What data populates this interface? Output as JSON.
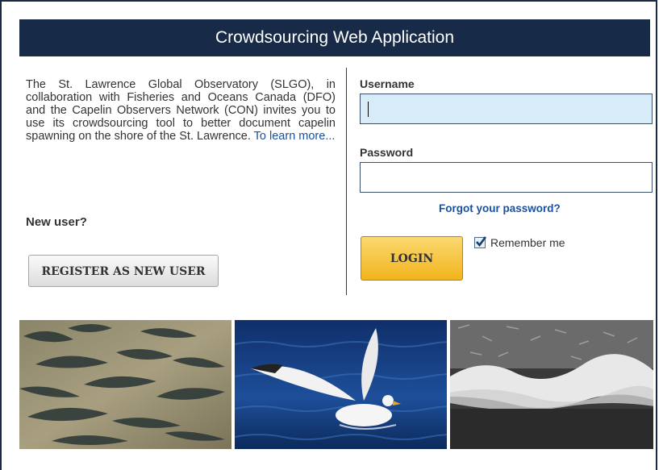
{
  "header": {
    "title": "Crowdsourcing Web Application"
  },
  "intro": {
    "text": "The St. Lawrence Global Observatory (SLGO), in collaboration with Fisheries and Oceans Canada (DFO) and the Capelin Observers Network (CON) invites you to use its crowdsourcing tool to better document capelin spawning on the shore of the St. Lawrence. ",
    "link_text": "To learn more..."
  },
  "new_user": {
    "heading": "New user?",
    "register_label": "REGISTER AS NEW USER"
  },
  "login": {
    "username_label": "Username",
    "username_value": "",
    "password_label": "Password",
    "password_value": "",
    "forgot_label": "Forgot your password?",
    "login_label": "LOGIN",
    "remember_label": "Remember me",
    "remember_checked": true
  },
  "photos": [
    {
      "name": "capelin-fish-photo"
    },
    {
      "name": "seagull-photo"
    },
    {
      "name": "capelin-shore-wave-photo"
    }
  ],
  "colors": {
    "header_bg": "#172a48",
    "link": "#1a4f9c",
    "login_button": "#f2b41d",
    "focused_input": "#d8ebf9"
  }
}
